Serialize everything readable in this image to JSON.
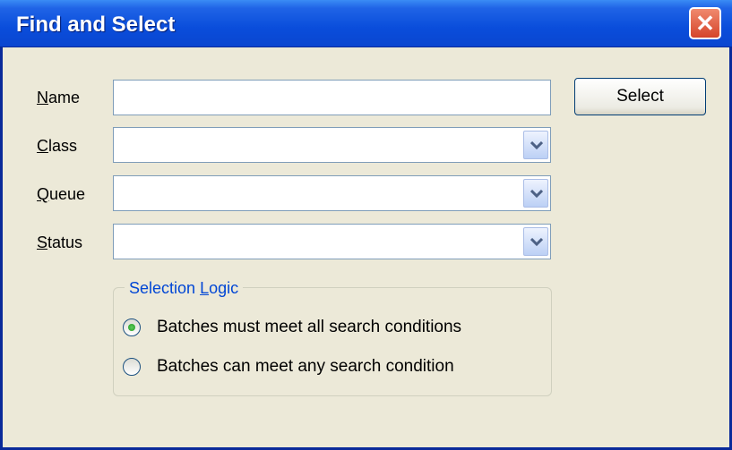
{
  "window": {
    "title": "Find and Select"
  },
  "form": {
    "name": {
      "label_ul": "N",
      "label_rest": "ame",
      "value": ""
    },
    "class": {
      "label_ul": "C",
      "label_rest": "lass",
      "value": ""
    },
    "queue": {
      "label_ul": "Q",
      "label_rest": "ueue",
      "value": ""
    },
    "status": {
      "label_ul": "S",
      "label_rest": "tatus",
      "value": ""
    }
  },
  "select_button": {
    "label": "Select"
  },
  "selection_logic": {
    "title_before": "Selection ",
    "title_ul": "L",
    "title_after": "ogic",
    "options": [
      {
        "label": "Batches must meet all search conditions",
        "selected": true
      },
      {
        "label": "Batches can meet any search condition",
        "selected": false
      }
    ]
  },
  "icons": {
    "close": "close-icon",
    "dropdown": "chevron-down-icon"
  },
  "colors": {
    "titlebar": "#0a4ddb",
    "group_title": "#0046d5",
    "dialog_bg": "#ece9d8"
  }
}
